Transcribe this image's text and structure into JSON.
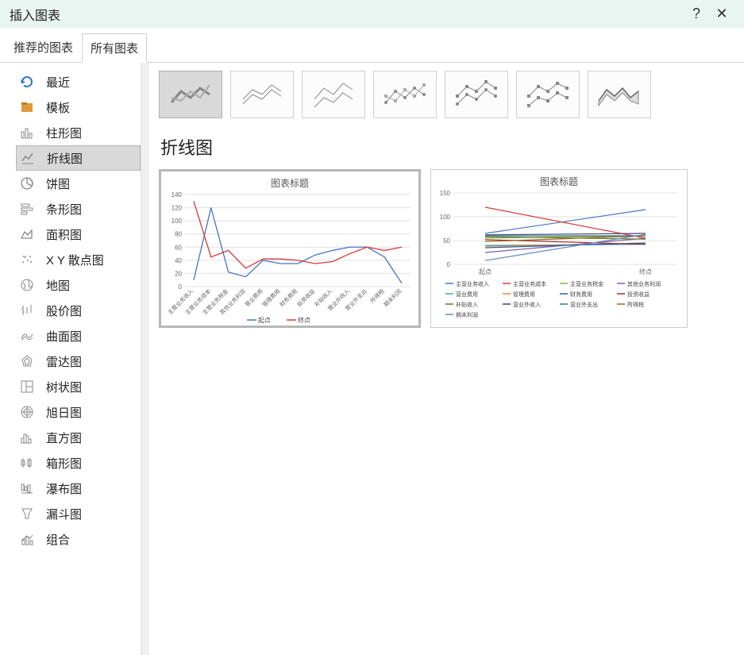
{
  "window": {
    "title": "插入图表",
    "help": "?",
    "close": "✕"
  },
  "tabs": {
    "recommended": "推荐的图表",
    "all": "所有图表"
  },
  "categories": [
    {
      "id": "recent",
      "label": "最近"
    },
    {
      "id": "template",
      "label": "模板"
    },
    {
      "id": "column",
      "label": "柱形图"
    },
    {
      "id": "line",
      "label": "折线图",
      "selected": true
    },
    {
      "id": "pie",
      "label": "饼图"
    },
    {
      "id": "bar",
      "label": "条形图"
    },
    {
      "id": "area",
      "label": "面积图"
    },
    {
      "id": "scatter",
      "label": "X Y 散点图"
    },
    {
      "id": "map",
      "label": "地图"
    },
    {
      "id": "stock",
      "label": "股价图"
    },
    {
      "id": "surface",
      "label": "曲面图"
    },
    {
      "id": "radar",
      "label": "雷达图"
    },
    {
      "id": "treemap",
      "label": "树状图"
    },
    {
      "id": "sunburst",
      "label": "旭日图"
    },
    {
      "id": "histogram",
      "label": "直方图"
    },
    {
      "id": "boxplot",
      "label": "箱形图"
    },
    {
      "id": "waterfall",
      "label": "瀑布图"
    },
    {
      "id": "funnel",
      "label": "漏斗图"
    },
    {
      "id": "combo",
      "label": "组合"
    }
  ],
  "section_title": "折线图",
  "preview1_title": "图表标题",
  "preview2_title": "图表标题",
  "chart_data": [
    {
      "type": "line",
      "title": "图表标题",
      "ylim": [
        0,
        140
      ],
      "yticks": [
        0,
        20,
        40,
        60,
        80,
        100,
        120,
        140
      ],
      "categories": [
        "主营业务收入",
        "主营业务成本",
        "主营业务税金",
        "其他业务利润",
        "营业费用",
        "管理费用",
        "财务费用",
        "投资收益",
        "补贴收入",
        "营业外收入",
        "营业外支出",
        "所得税",
        "期末利润"
      ],
      "series": [
        {
          "name": "起点",
          "color": "#4573c4",
          "values": [
            10,
            120,
            22,
            15,
            40,
            35,
            35,
            48,
            55,
            60,
            60,
            45,
            5
          ]
        },
        {
          "name": "终点",
          "color": "#d93a3a",
          "values": [
            130,
            45,
            55,
            28,
            42,
            42,
            40,
            35,
            38,
            50,
            60,
            55,
            60
          ]
        }
      ],
      "legend": [
        "起点",
        "终点"
      ]
    },
    {
      "type": "line",
      "title": "图表标题",
      "ylim": [
        0,
        150
      ],
      "yticks": [
        0,
        50,
        100,
        150
      ],
      "categories": [
        "起点",
        "终点"
      ],
      "series": [
        {
          "name": "主营业务收入",
          "color": "#4573c4",
          "values": [
            65,
            115
          ]
        },
        {
          "name": "主营业务成本",
          "color": "#d93a3a",
          "values": [
            120,
            55
          ]
        },
        {
          "name": "主营业务税金",
          "color": "#8db83a",
          "values": [
            55,
            60
          ]
        },
        {
          "name": "其他业务利润",
          "color": "#7a5da8",
          "values": [
            25,
            55
          ]
        },
        {
          "name": "营业费用",
          "color": "#3da9d0",
          "values": [
            40,
            42
          ]
        },
        {
          "name": "管理费用",
          "color": "#e08c2c",
          "values": [
            38,
            44
          ]
        },
        {
          "name": "财务费用",
          "color": "#2b5aa0",
          "values": [
            35,
            45
          ]
        },
        {
          "name": "投资收益",
          "color": "#9c2e2e",
          "values": [
            52,
            42
          ]
        },
        {
          "name": "补贴收入",
          "color": "#5a7a2a",
          "values": [
            58,
            53
          ]
        },
        {
          "name": "营业外收入",
          "color": "#4a3a70",
          "values": [
            62,
            65
          ]
        },
        {
          "name": "营业外支出",
          "color": "#2a7a8c",
          "values": [
            60,
            60
          ]
        },
        {
          "name": "所得税",
          "color": "#a0641e",
          "values": [
            48,
            60
          ]
        },
        {
          "name": "期末利润",
          "color": "#5a8ac9",
          "values": [
            8,
            63
          ]
        }
      ]
    }
  ]
}
